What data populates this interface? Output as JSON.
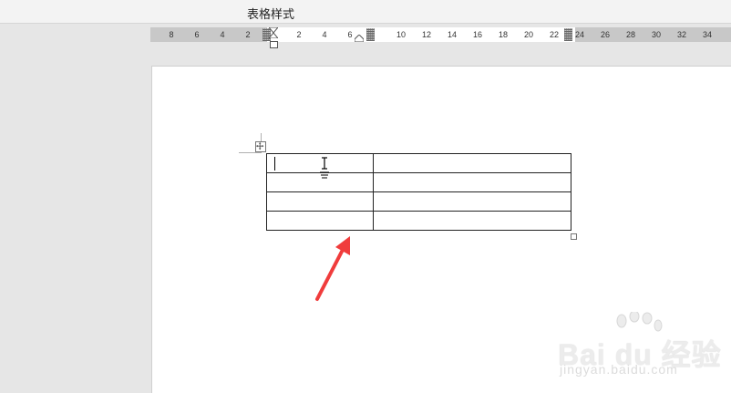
{
  "ribbon": {
    "active_tab": "表格样式"
  },
  "ruler": {
    "numbers": [
      "8",
      "6",
      "4",
      "2",
      "2",
      "4",
      "6",
      "10",
      "12",
      "14",
      "16",
      "18",
      "20",
      "22",
      "24",
      "26",
      "28",
      "30",
      "32",
      "34"
    ]
  },
  "watermark": {
    "main": "Bai du 经验",
    "sub": "jingyan.baidu.com"
  },
  "colors": {
    "arrow": "#f03c3c",
    "page": "#ffffff",
    "workspace": "#e6e6e6"
  },
  "table": {
    "rows": 4,
    "cols": 2,
    "cells": [
      [
        "",
        ""
      ],
      [
        "",
        ""
      ],
      [
        "",
        ""
      ],
      [
        "",
        ""
      ]
    ]
  }
}
